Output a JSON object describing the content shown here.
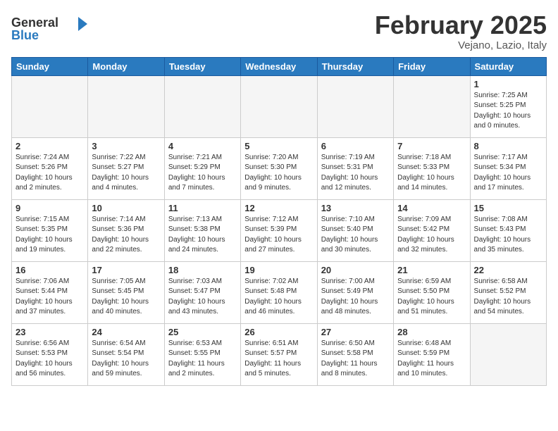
{
  "header": {
    "logo_general": "General",
    "logo_blue": "Blue",
    "month_title": "February 2025",
    "location": "Vejano, Lazio, Italy"
  },
  "weekdays": [
    "Sunday",
    "Monday",
    "Tuesday",
    "Wednesday",
    "Thursday",
    "Friday",
    "Saturday"
  ],
  "weeks": [
    [
      {
        "num": "",
        "empty": true
      },
      {
        "num": "",
        "empty": true
      },
      {
        "num": "",
        "empty": true
      },
      {
        "num": "",
        "empty": true
      },
      {
        "num": "",
        "empty": true
      },
      {
        "num": "",
        "empty": true
      },
      {
        "num": "1",
        "info": "Sunrise: 7:25 AM\nSunset: 5:25 PM\nDaylight: 10 hours\nand 0 minutes."
      }
    ],
    [
      {
        "num": "2",
        "info": "Sunrise: 7:24 AM\nSunset: 5:26 PM\nDaylight: 10 hours\nand 2 minutes."
      },
      {
        "num": "3",
        "info": "Sunrise: 7:22 AM\nSunset: 5:27 PM\nDaylight: 10 hours\nand 4 minutes."
      },
      {
        "num": "4",
        "info": "Sunrise: 7:21 AM\nSunset: 5:29 PM\nDaylight: 10 hours\nand 7 minutes."
      },
      {
        "num": "5",
        "info": "Sunrise: 7:20 AM\nSunset: 5:30 PM\nDaylight: 10 hours\nand 9 minutes."
      },
      {
        "num": "6",
        "info": "Sunrise: 7:19 AM\nSunset: 5:31 PM\nDaylight: 10 hours\nand 12 minutes."
      },
      {
        "num": "7",
        "info": "Sunrise: 7:18 AM\nSunset: 5:33 PM\nDaylight: 10 hours\nand 14 minutes."
      },
      {
        "num": "8",
        "info": "Sunrise: 7:17 AM\nSunset: 5:34 PM\nDaylight: 10 hours\nand 17 minutes."
      }
    ],
    [
      {
        "num": "9",
        "info": "Sunrise: 7:15 AM\nSunset: 5:35 PM\nDaylight: 10 hours\nand 19 minutes."
      },
      {
        "num": "10",
        "info": "Sunrise: 7:14 AM\nSunset: 5:36 PM\nDaylight: 10 hours\nand 22 minutes."
      },
      {
        "num": "11",
        "info": "Sunrise: 7:13 AM\nSunset: 5:38 PM\nDaylight: 10 hours\nand 24 minutes."
      },
      {
        "num": "12",
        "info": "Sunrise: 7:12 AM\nSunset: 5:39 PM\nDaylight: 10 hours\nand 27 minutes."
      },
      {
        "num": "13",
        "info": "Sunrise: 7:10 AM\nSunset: 5:40 PM\nDaylight: 10 hours\nand 30 minutes."
      },
      {
        "num": "14",
        "info": "Sunrise: 7:09 AM\nSunset: 5:42 PM\nDaylight: 10 hours\nand 32 minutes."
      },
      {
        "num": "15",
        "info": "Sunrise: 7:08 AM\nSunset: 5:43 PM\nDaylight: 10 hours\nand 35 minutes."
      }
    ],
    [
      {
        "num": "16",
        "info": "Sunrise: 7:06 AM\nSunset: 5:44 PM\nDaylight: 10 hours\nand 37 minutes."
      },
      {
        "num": "17",
        "info": "Sunrise: 7:05 AM\nSunset: 5:45 PM\nDaylight: 10 hours\nand 40 minutes."
      },
      {
        "num": "18",
        "info": "Sunrise: 7:03 AM\nSunset: 5:47 PM\nDaylight: 10 hours\nand 43 minutes."
      },
      {
        "num": "19",
        "info": "Sunrise: 7:02 AM\nSunset: 5:48 PM\nDaylight: 10 hours\nand 46 minutes."
      },
      {
        "num": "20",
        "info": "Sunrise: 7:00 AM\nSunset: 5:49 PM\nDaylight: 10 hours\nand 48 minutes."
      },
      {
        "num": "21",
        "info": "Sunrise: 6:59 AM\nSunset: 5:50 PM\nDaylight: 10 hours\nand 51 minutes."
      },
      {
        "num": "22",
        "info": "Sunrise: 6:58 AM\nSunset: 5:52 PM\nDaylight: 10 hours\nand 54 minutes."
      }
    ],
    [
      {
        "num": "23",
        "info": "Sunrise: 6:56 AM\nSunset: 5:53 PM\nDaylight: 10 hours\nand 56 minutes."
      },
      {
        "num": "24",
        "info": "Sunrise: 6:54 AM\nSunset: 5:54 PM\nDaylight: 10 hours\nand 59 minutes."
      },
      {
        "num": "25",
        "info": "Sunrise: 6:53 AM\nSunset: 5:55 PM\nDaylight: 11 hours\nand 2 minutes."
      },
      {
        "num": "26",
        "info": "Sunrise: 6:51 AM\nSunset: 5:57 PM\nDaylight: 11 hours\nand 5 minutes."
      },
      {
        "num": "27",
        "info": "Sunrise: 6:50 AM\nSunset: 5:58 PM\nDaylight: 11 hours\nand 8 minutes."
      },
      {
        "num": "28",
        "info": "Sunrise: 6:48 AM\nSunset: 5:59 PM\nDaylight: 11 hours\nand 10 minutes."
      },
      {
        "num": "",
        "empty": true
      }
    ]
  ]
}
